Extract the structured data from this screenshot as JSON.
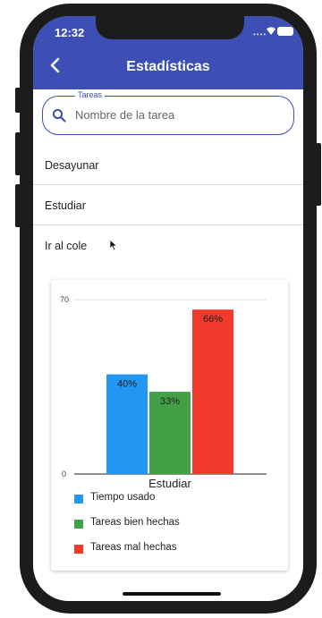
{
  "status_bar": {
    "time": "12:32"
  },
  "app_bar": {
    "title": "Estadísticas",
    "back_icon": "chevron-left-icon"
  },
  "search": {
    "legend": "Tareas",
    "placeholder": "Nombre de la tarea",
    "value": "",
    "icon": "search-icon"
  },
  "tasks": [
    {
      "label": "Desayunar"
    },
    {
      "label": "Estudiar"
    },
    {
      "label": "Ir al cole"
    }
  ],
  "colors": {
    "primary": "#3d4fb5",
    "series_blue": "#2196f3",
    "series_green": "#43a047",
    "series_red": "#f03b2c"
  },
  "chart_data": {
    "type": "bar",
    "categories": [
      "Estudiar"
    ],
    "series": [
      {
        "name": "Tiempo usado",
        "values": [
          40
        ],
        "label": "40%",
        "color": "#2196f3"
      },
      {
        "name": "Tareas bien hechas",
        "values": [
          33
        ],
        "label": "33%",
        "color": "#43a047"
      },
      {
        "name": "Tareas mal hechas",
        "values": [
          66
        ],
        "label": "66%",
        "color": "#f03b2c"
      }
    ],
    "ylim": [
      0,
      70
    ],
    "y_ticks": [
      "0",
      "70"
    ],
    "grid": true,
    "legend_position": "bottom-left"
  }
}
